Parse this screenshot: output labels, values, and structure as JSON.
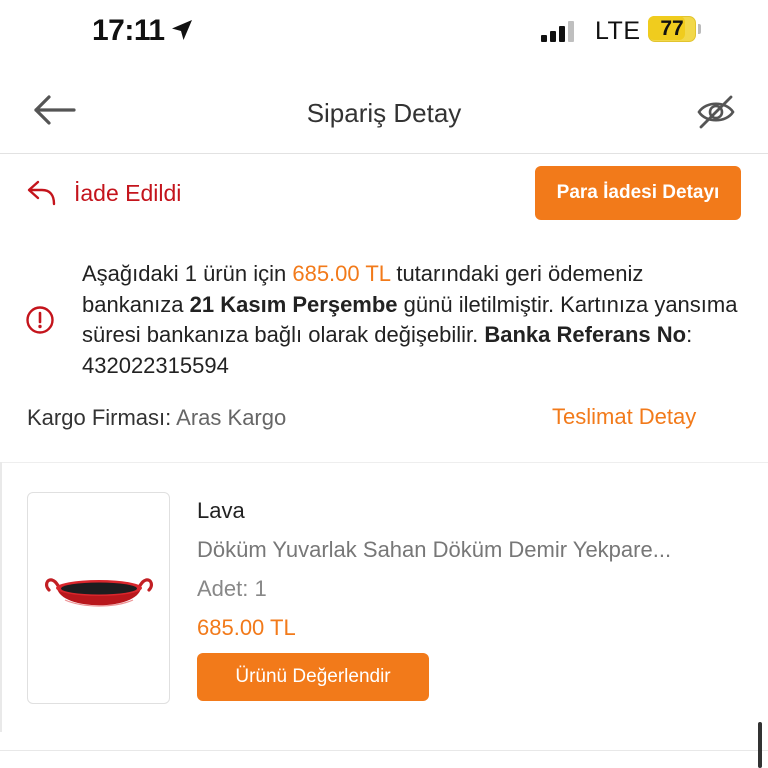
{
  "status_bar": {
    "time": "17:11",
    "network": "LTE",
    "battery": "77",
    "battery_level": 0.77,
    "location_icon": "location-arrow-icon",
    "signal_icon": "cellular-signal-icon"
  },
  "header": {
    "title": "Sipariş Detay",
    "back_icon": "back-arrow-icon",
    "visibility_icon": "eye-slash-icon"
  },
  "refund": {
    "status_label": "İade Edildi",
    "status_icon": "return-arrow-icon",
    "detail_button": "Para İadesi Detayı",
    "info_icon": "info-circle-icon",
    "info": {
      "part1": "Aşağıdaki 1 ürün için ",
      "amount": "685.00 TL",
      "part2": " tutarındaki geri ödemeniz bankanıza ",
      "date": "21 Kasım Perşembe",
      "part3": " günü iletilmiştir. Kartınıza yansıma süresi bankanıza bağlı olarak değişebilir. ",
      "ref_label": "Banka Referans No",
      "ref_sep": ": ",
      "ref_number": "432022315594"
    }
  },
  "cargo": {
    "label": "Kargo Firması:",
    "value": "Aras Kargo",
    "delivery_link": "Teslimat Detay"
  },
  "product": {
    "brand": "Lava",
    "name": "Döküm Yuvarlak Sahan Döküm Demir Yekpare...",
    "quantity_label": "Adet:",
    "quantity": "1",
    "price": "685.00 TL",
    "review_button": "Ürünü Değerlendir",
    "image_icon": "cast-iron-pan-image"
  },
  "colors": {
    "accent": "#f27a1a",
    "refund_red": "#c4141c",
    "battery": "#f2d84a"
  }
}
